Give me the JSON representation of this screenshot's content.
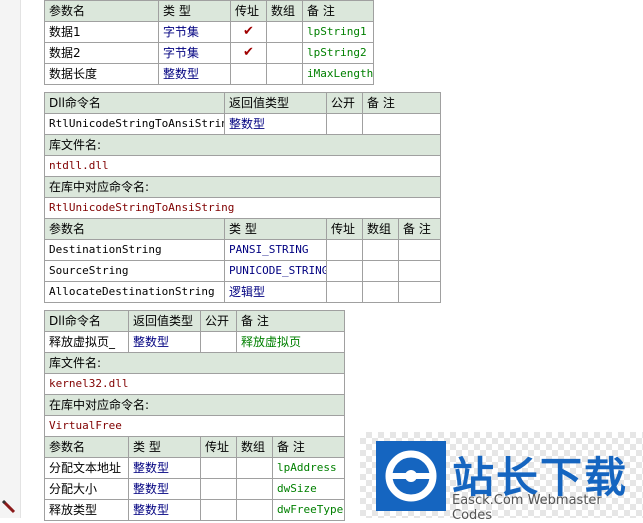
{
  "table1": {
    "headers": [
      "参数名",
      "类 型",
      "传址",
      "数组",
      "备 注"
    ],
    "rows": [
      {
        "name": "数据1",
        "type": "字节集",
        "byref": "✔",
        "array": "",
        "remark": "lpString1"
      },
      {
        "name": "数据2",
        "type": "字节集",
        "byref": "✔",
        "array": "",
        "remark": "lpString2"
      },
      {
        "name": "数据长度",
        "type": "整数型",
        "byref": "",
        "array": "",
        "remark": "iMaxLength"
      }
    ]
  },
  "table2": {
    "cmd_headers": [
      "Dll命令名",
      "返回值类型",
      "公开",
      "备 注"
    ],
    "cmd": {
      "name": "RtlUnicodeStringToAnsiString",
      "return_type": "整数型",
      "public": "",
      "remark": ""
    },
    "lib_label": "库文件名:",
    "lib_value": "ntdll.dll",
    "entry_label": "在库中对应命令名:",
    "entry_value": "RtlUnicodeStringToAnsiString",
    "param_headers": [
      "参数名",
      "类 型",
      "传址",
      "数组",
      "备 注"
    ],
    "params": [
      {
        "name": "DestinationString",
        "type": "PANSI_STRING",
        "byref": "",
        "array": "",
        "remark": ""
      },
      {
        "name": "SourceString",
        "type": "PUNICODE_STRING",
        "byref": "",
        "array": "",
        "remark": ""
      },
      {
        "name": "AllocateDestinationString",
        "type": "逻辑型",
        "byref": "",
        "array": "",
        "remark": ""
      }
    ]
  },
  "table3": {
    "cmd_headers": [
      "Dll命令名",
      "返回值类型",
      "公开",
      "备 注"
    ],
    "cmd": {
      "name": "释放虚拟页_",
      "return_type": "整数型",
      "public": "",
      "remark": "释放虚拟页"
    },
    "lib_label": "库文件名:",
    "lib_value": "kernel32.dll",
    "entry_label": "在库中对应命令名:",
    "entry_value": "VirtualFree",
    "param_headers": [
      "参数名",
      "类 型",
      "传址",
      "数组",
      "备 注"
    ],
    "params": [
      {
        "name": "分配文本地址",
        "type": "整数型",
        "byref": "",
        "array": "",
        "remark": "lpAddress"
      },
      {
        "name": "分配大小",
        "type": "整数型",
        "byref": "",
        "array": "",
        "remark": "dwSize"
      },
      {
        "name": "释放类型",
        "type": "整数型",
        "byref": "",
        "array": "",
        "remark": "dwFreeType"
      }
    ]
  },
  "watermark": {
    "title": "站长下载",
    "subtitle": "Easck.Com Webmaster Codes"
  },
  "colors": {
    "header_bg": "#dbe7db",
    "type_text": "#000080",
    "remark_text": "#008000",
    "lib_text": "#800000",
    "check": "#a00000",
    "logo": "#1565c0"
  }
}
